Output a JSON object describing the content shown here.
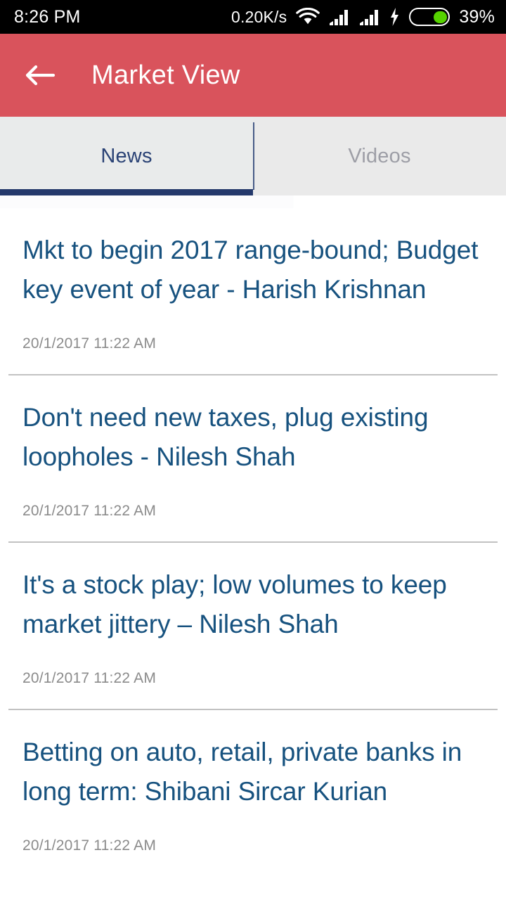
{
  "status_bar": {
    "time": "8:26 PM",
    "network_speed": "0.20K/s",
    "wifi_icon": "wifi-icon",
    "signal_icon_1": "signal-bars-icon",
    "signal_icon_2": "signal-bars-icon",
    "charging_icon": "lightning-bolt-icon",
    "battery_icon": "battery-icon",
    "battery_percent": "39%",
    "battery_level": 39,
    "colors": {
      "background": "#000000",
      "text": "#ffffff",
      "battery_fill": "#56d200"
    }
  },
  "app_bar": {
    "back_icon": "back-arrow-icon",
    "title": "Market View",
    "colors": {
      "background": "#d9535c",
      "text": "#ffffff"
    }
  },
  "tabs": {
    "active_index": 0,
    "items": [
      {
        "label": "News",
        "active": true
      },
      {
        "label": "Videos",
        "active": false
      }
    ],
    "colors": {
      "bar_background": "#eaeaea",
      "active_text": "#2a4275",
      "inactive_text": "#9d9ea6",
      "indicator": "#24396b"
    }
  },
  "news": {
    "colors": {
      "title": "#17527f",
      "timestamp": "#8b8b8b",
      "divider": "#c2c2c2"
    },
    "items": [
      {
        "title": "Mkt to begin 2017 range-bound; Budget key event of year - Harish Krishnan",
        "timestamp": "20/1/2017 11:22 AM"
      },
      {
        "title": "Don't need new taxes, plug existing loopholes - Nilesh Shah",
        "timestamp": "20/1/2017 11:22 AM"
      },
      {
        "title": "It's a stock play; low volumes to keep market jittery – Nilesh Shah",
        "timestamp": "20/1/2017 11:22 AM"
      },
      {
        "title": "Betting on auto, retail, private banks in long term: Shibani Sircar Kurian",
        "timestamp": "20/1/2017 11:22 AM"
      }
    ]
  }
}
